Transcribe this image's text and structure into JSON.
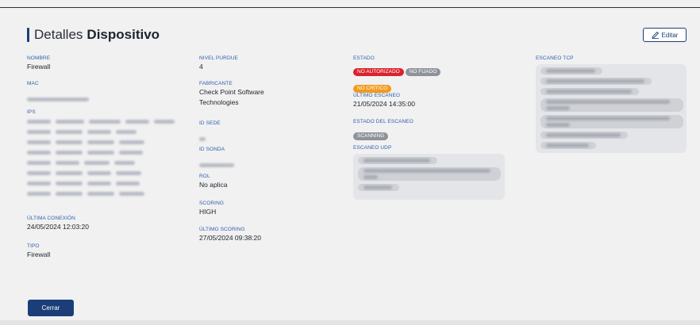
{
  "header": {
    "title_light": "Detalles",
    "title_bold": "Dispositivo",
    "edit_label": "Editar"
  },
  "col1": {
    "nombre": {
      "label": "NOMBRE",
      "value": "Firewall"
    },
    "mac": {
      "label": "MAC"
    },
    "ips": {
      "label": "IPs"
    },
    "ultima_conexion": {
      "label": "ÚLTIMA CONEXIÓN",
      "value": "24/05/2024 12:03:20"
    },
    "tipo": {
      "label": "TIPO",
      "value": "Firewall"
    }
  },
  "col2": {
    "nivel_purdue": {
      "label": "NIVEL PURDUE",
      "value": "4"
    },
    "fabricante": {
      "label": "FABRICANTE",
      "value_line1": "Check Point Software",
      "value_line2": "Technologies"
    },
    "id_sede": {
      "label": "ID SEDE"
    },
    "id_sonda": {
      "label": "ID SONDA"
    },
    "rol": {
      "label": "ROL",
      "value": "No aplica"
    },
    "scoring": {
      "label": "SCORING",
      "value": "HIGH"
    },
    "ultimo_scoring": {
      "label": "ÚLTIMO SCORING",
      "value": "27/05/2024 09:38:20"
    }
  },
  "col3": {
    "estado": {
      "label": "ESTADO",
      "badges": [
        "NO AUTORIZADO",
        "NO FIJADO",
        "NO CRÍTICO"
      ]
    },
    "ultimo_escaneo": {
      "label": "ÚLTIMO ESCANEO",
      "value": "21/05/2024 14:35:00"
    },
    "estado_escaneo": {
      "label": "ESTADO DEL ESCANEO",
      "badge": "SCANNING"
    },
    "escaneo_udp": {
      "label": "ESCANEO UDP"
    }
  },
  "col4": {
    "escaneo_tcp": {
      "label": "ESCANEO TCP"
    }
  },
  "footer": {
    "close_label": "Cerrar"
  },
  "colors": {
    "accent": "#1b3e78",
    "label": "#2f5fa8",
    "badge_red": "#d9232d",
    "badge_gray": "#8e9299",
    "badge_orange": "#f39a1d"
  }
}
